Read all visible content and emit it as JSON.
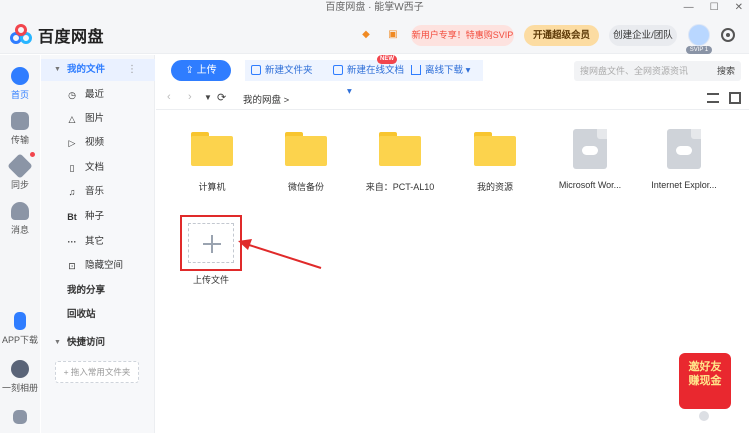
{
  "window": {
    "title": "百度网盘 · 能掌W西子",
    "controls": [
      "—",
      "☐",
      "✕"
    ]
  },
  "header": {
    "logo_text": "百度网盘",
    "promo": "新用户专享！特惠购SVIP",
    "vip_button": "开通超级会员",
    "team_button": "创建企业/团队",
    "avatar_badge": "SVIP 1"
  },
  "rail": {
    "items": [
      {
        "label": "首页",
        "icon": "home-icon"
      },
      {
        "label": "传输",
        "icon": "transfer-icon"
      },
      {
        "label": "同步",
        "icon": "sync-icon"
      },
      {
        "label": "消息",
        "icon": "message-icon"
      },
      {
        "label": "APP下载",
        "icon": "phone-icon"
      },
      {
        "label": "一刻相册",
        "icon": "album-icon"
      }
    ]
  },
  "sidebar": {
    "my_files": "我的文件",
    "items": [
      {
        "label": "最近",
        "glyph": "◷"
      },
      {
        "label": "图片",
        "glyph": "△"
      },
      {
        "label": "视频",
        "glyph": "▷"
      },
      {
        "label": "文档",
        "glyph": "▯"
      },
      {
        "label": "音乐",
        "glyph": "♫"
      },
      {
        "label": "种子",
        "glyph": "Bt"
      },
      {
        "label": "其它",
        "glyph": "···"
      },
      {
        "label": "隐藏空间",
        "glyph": "⊡"
      }
    ],
    "my_share": "我的分享",
    "recycle": "回收站",
    "quick_access": "快捷访问",
    "drag_hint": "+ 拖入常用文件夹"
  },
  "toolbar": {
    "upload": "上传",
    "new_folder": "新建文件夹",
    "new_online_doc": "新建在线文档",
    "new_badge": "NEW",
    "offline_download": "离线下载",
    "search_placeholder": "搜网盘文件、全网资源资讯",
    "search_button": "搜索"
  },
  "path": {
    "current": "我的网盘 >"
  },
  "files": [
    {
      "name": "计算机",
      "type": "folder"
    },
    {
      "name": "微信备份",
      "type": "folder"
    },
    {
      "name": "来自：PCT-AL10",
      "type": "folder"
    },
    {
      "name": "我的资源",
      "type": "folder"
    },
    {
      "name": "Microsoft Wor...",
      "type": "doc"
    },
    {
      "name": "Internet Explor...",
      "type": "doc"
    }
  ],
  "upload_tile": {
    "label": "上传文件"
  },
  "invite": {
    "line1": "邀好友",
    "line2": "赚现金"
  },
  "colors": {
    "accent": "#2f7dff",
    "folder": "#fcd34d",
    "highlight": "#e02a2a"
  }
}
